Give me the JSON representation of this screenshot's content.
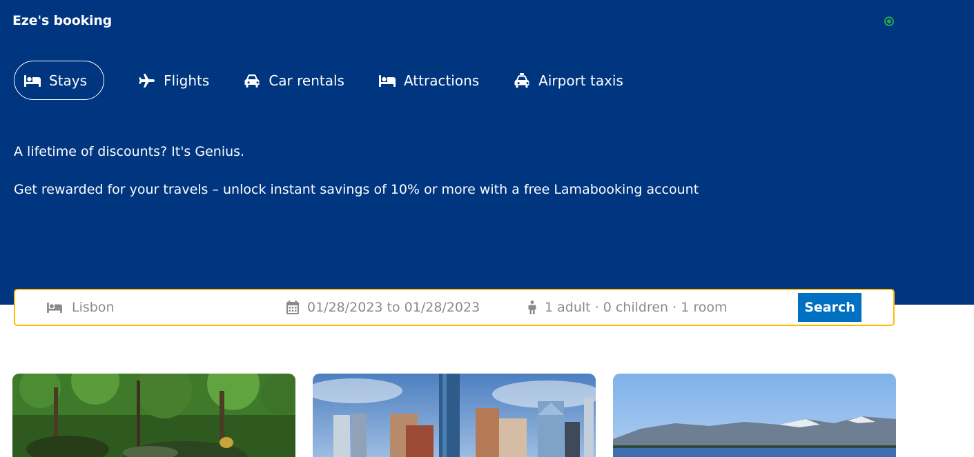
{
  "app": {
    "brand": "Eze's booking"
  },
  "nav": {
    "items": [
      {
        "label": "Stays",
        "icon": "bed-icon",
        "active": true
      },
      {
        "label": "Flights",
        "icon": "plane-icon",
        "active": false
      },
      {
        "label": "Car rentals",
        "icon": "car-icon",
        "active": false
      },
      {
        "label": "Attractions",
        "icon": "bed-icon",
        "active": false
      },
      {
        "label": "Airport taxis",
        "icon": "taxi-icon",
        "active": false
      }
    ]
  },
  "promo": {
    "title": "A lifetime of discounts? It's Genius.",
    "text": "Get rewarded for your travels – unlock instant savings of 10% or more with a free Lamabooking account"
  },
  "search": {
    "destination": "Lisbon",
    "dates": "01/28/2023 to 01/28/2023",
    "guests": "1 adult · 0 children · 1 room",
    "button_label": "Search"
  },
  "colors": {
    "hero_bg": "#003580",
    "search_border": "#febb02",
    "search_button": "#0071c2",
    "status_online": "#2aa54a"
  },
  "featured": [
    {
      "image": "forest-stream-photo"
    },
    {
      "image": "city-skyline-photo"
    },
    {
      "image": "mountain-lake-photo"
    }
  ]
}
